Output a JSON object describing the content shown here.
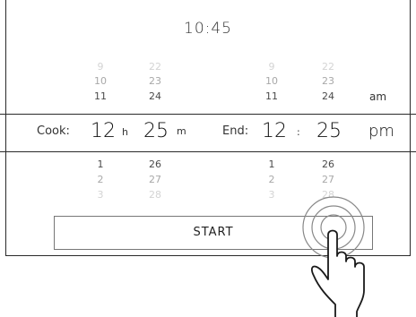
{
  "clock": "10:45",
  "cook": {
    "label": "Cook:",
    "hours": "12",
    "hours_unit": "h",
    "minutes": "25",
    "minutes_unit": "m",
    "hours_above": [
      "9",
      "10",
      "11"
    ],
    "minutes_above": [
      "22",
      "23",
      "24"
    ],
    "hours_below": [
      "1",
      "2",
      "3"
    ],
    "minutes_below": [
      "26",
      "27",
      "28"
    ]
  },
  "end": {
    "label": "End:",
    "hours": "12",
    "separator": ":",
    "minutes": "25",
    "period": "pm",
    "period_above": "am",
    "hours_above": [
      "9",
      "10",
      "11"
    ],
    "minutes_above": [
      "22",
      "23",
      "24"
    ],
    "hours_below": [
      "1",
      "2",
      "3"
    ],
    "minutes_below": [
      "26",
      "27",
      "28"
    ]
  },
  "start_label": "START",
  "icons": {
    "hand": "tap-hand-icon"
  }
}
